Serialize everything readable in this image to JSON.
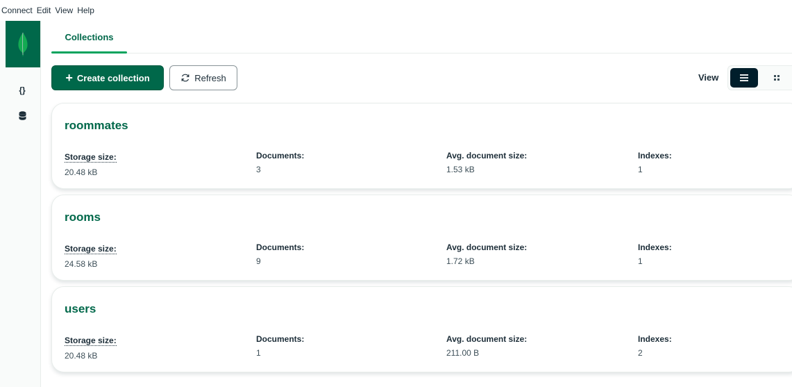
{
  "menu": [
    "Connect",
    "Edit",
    "View",
    "Help"
  ],
  "sidebar": {
    "logo_icon": "leaf-icon",
    "items": [
      {
        "icon": "braces-icon",
        "glyph": "{}"
      },
      {
        "icon": "database-icon"
      }
    ]
  },
  "tabs": [
    {
      "label": "Collections",
      "active": true
    }
  ],
  "toolbar": {
    "create_label": "Create collection",
    "refresh_label": "Refresh",
    "view_label": "View",
    "view_mode": "list"
  },
  "colors": {
    "brand": "#00684a",
    "accent": "#00a35c",
    "dark": "#001e2b"
  },
  "stat_labels": {
    "storage": "Storage size:",
    "documents": "Documents:",
    "avg_size": "Avg. document size:",
    "indexes": "Indexes:"
  },
  "collections": [
    {
      "name": "roommates",
      "storage_size": "20.48 kB",
      "documents": "3",
      "avg_document_size": "1.53 kB",
      "indexes": "1"
    },
    {
      "name": "rooms",
      "storage_size": "24.58 kB",
      "documents": "9",
      "avg_document_size": "1.72 kB",
      "indexes": "1"
    },
    {
      "name": "users",
      "storage_size": "20.48 kB",
      "documents": "1",
      "avg_document_size": "211.00 B",
      "indexes": "2"
    }
  ]
}
